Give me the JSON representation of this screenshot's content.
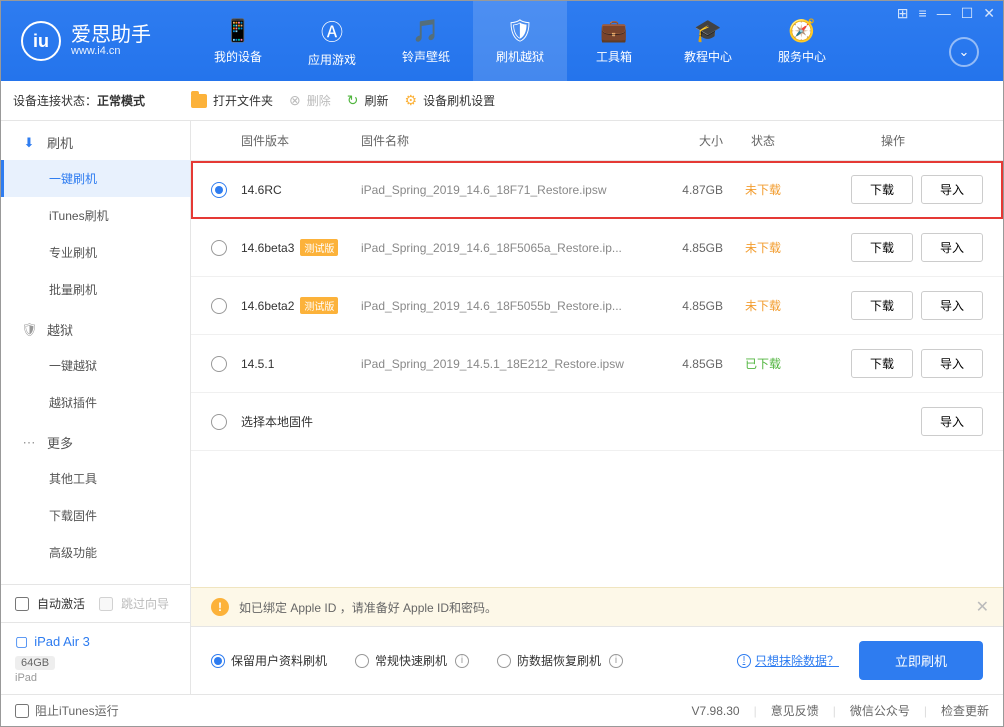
{
  "logo": {
    "title": "爱思助手",
    "url": "www.i4.cn"
  },
  "nav": {
    "tabs": [
      {
        "label": "我的设备",
        "icon": "📱"
      },
      {
        "label": "应用游戏",
        "icon": "Ⓐ"
      },
      {
        "label": "铃声壁纸",
        "icon": "🎵"
      },
      {
        "label": "刷机越狱",
        "icon": "🛡"
      },
      {
        "label": "工具箱",
        "icon": "💼"
      },
      {
        "label": "教程中心",
        "icon": "🎓"
      },
      {
        "label": "服务中心",
        "icon": "🧭"
      }
    ]
  },
  "device_status": {
    "label": "设备连接状态：",
    "value": "正常模式"
  },
  "toolbar": {
    "open_folder": "打开文件夹",
    "delete": "删除",
    "refresh": "刷新",
    "device_settings": "设备刷机设置"
  },
  "sidebar": {
    "groups": [
      {
        "icon": "⬇",
        "icon_color": "#2e7cf0",
        "label": "刷机",
        "items": [
          "一键刷机",
          "iTunes刷机",
          "专业刷机",
          "批量刷机"
        ]
      },
      {
        "icon": "🛡",
        "icon_color": "#999",
        "label": "越狱",
        "items": [
          "一键越狱",
          "越狱插件"
        ]
      },
      {
        "icon": "⋯",
        "icon_color": "#999",
        "label": "更多",
        "items": [
          "其他工具",
          "下载固件",
          "高级功能"
        ]
      }
    ],
    "active_item": "一键刷机",
    "auto_activate": "自动激活",
    "skip_wizard": "跳过向导",
    "device": {
      "name": "iPad Air 3",
      "storage": "64GB",
      "type": "iPad"
    }
  },
  "table": {
    "headers": {
      "version": "固件版本",
      "name": "固件名称",
      "size": "大小",
      "status": "状态",
      "actions": "操作"
    },
    "rows": [
      {
        "version": "14.6RC",
        "beta": false,
        "name": "iPad_Spring_2019_14.6_18F71_Restore.ipsw",
        "size": "4.87GB",
        "status": "未下载",
        "status_class": "not-downloaded",
        "selected": true,
        "highlighted": true,
        "buttons": [
          "下载",
          "导入"
        ]
      },
      {
        "version": "14.6beta3",
        "beta": true,
        "name": "iPad_Spring_2019_14.6_18F5065a_Restore.ip...",
        "size": "4.85GB",
        "status": "未下载",
        "status_class": "not-downloaded",
        "selected": false,
        "buttons": [
          "下载",
          "导入"
        ]
      },
      {
        "version": "14.6beta2",
        "beta": true,
        "name": "iPad_Spring_2019_14.6_18F5055b_Restore.ip...",
        "size": "4.85GB",
        "status": "未下载",
        "status_class": "not-downloaded",
        "selected": false,
        "buttons": [
          "下载",
          "导入"
        ]
      },
      {
        "version": "14.5.1",
        "beta": false,
        "name": "iPad_Spring_2019_14.5.1_18E212_Restore.ipsw",
        "size": "4.85GB",
        "status": "已下载",
        "status_class": "downloaded",
        "selected": false,
        "buttons": [
          "下载",
          "导入"
        ]
      },
      {
        "version": "选择本地固件",
        "beta": false,
        "name": "",
        "size": "",
        "status": "",
        "selected": false,
        "buttons": [
          "导入"
        ]
      }
    ],
    "beta_badge": "测试版"
  },
  "warning": {
    "text": "如已绑定 Apple ID ，请准备好 Apple ID和密码。"
  },
  "options": {
    "items": [
      {
        "label": "保留用户资料刷机",
        "selected": true,
        "info": false
      },
      {
        "label": "常规快速刷机",
        "selected": false,
        "info": true
      },
      {
        "label": "防数据恢复刷机",
        "selected": false,
        "info": true
      }
    ],
    "erase_link": "只想抹除数据？",
    "primary": "立即刷机"
  },
  "footer": {
    "block_itunes": "阻止iTunes运行",
    "version": "V7.98.30",
    "links": [
      "意见反馈",
      "微信公众号",
      "检查更新"
    ]
  }
}
